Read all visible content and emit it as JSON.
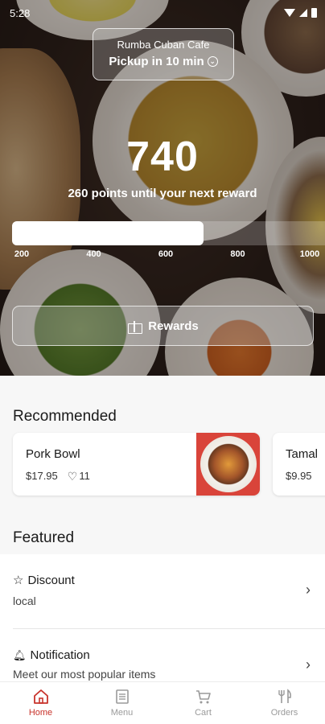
{
  "status_bar": {
    "time": "5:28"
  },
  "hero": {
    "store_name": "Rumba Cuban Cafe",
    "pickup_text": "Pickup in 10 min",
    "points": "740",
    "points_subtitle": "260 points until your next reward",
    "progress": {
      "value": 740,
      "min": 200,
      "max": 1000
    },
    "ticks": [
      "200",
      "400",
      "600",
      "800",
      "1000"
    ],
    "rewards_button_label": "Rewards"
  },
  "recommended": {
    "title": "Recommended",
    "items": [
      {
        "name": "Pork Bowl",
        "price": "$17.95",
        "likes": "11"
      },
      {
        "name": "Tamal",
        "price": "$9.95"
      }
    ]
  },
  "featured": {
    "title": "Featured",
    "items": [
      {
        "title": "Discount",
        "subtitle": "local",
        "icon": "star-icon"
      },
      {
        "title": "Notification",
        "subtitle": "Meet our most popular items",
        "icon": "bell-icon"
      }
    ]
  },
  "bottom_nav": {
    "items": [
      {
        "label": "Home",
        "icon": "home-icon",
        "active": true
      },
      {
        "label": "Menu",
        "icon": "menu-icon",
        "active": false
      },
      {
        "label": "Cart",
        "icon": "cart-icon",
        "active": false
      },
      {
        "label": "Orders",
        "icon": "orders-icon",
        "active": false
      }
    ]
  },
  "colors": {
    "accent": "#c8332b",
    "inactive_nav": "#9a9a9a",
    "card_image_bg": "#d9443a"
  }
}
